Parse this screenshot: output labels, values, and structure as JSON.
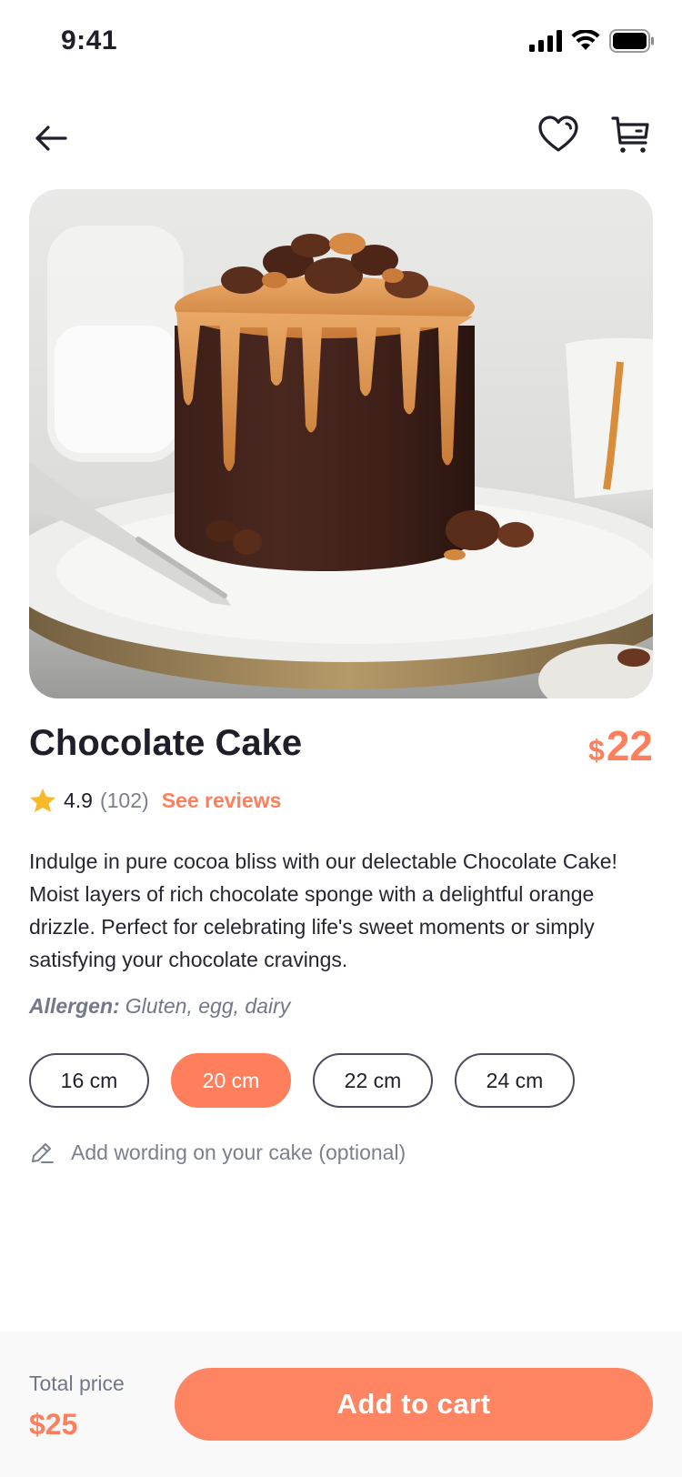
{
  "status_bar": {
    "time": "9:41"
  },
  "nav": {
    "back_icon": "arrow-left-icon",
    "favorite_icon": "heart-icon",
    "cart_icon": "shopping-cart-icon"
  },
  "product": {
    "name": "Chocolate Cake",
    "currency": "$",
    "price": "22",
    "rating": "4.9",
    "review_count": "(102)",
    "see_reviews_label": "See reviews",
    "description": "Indulge in pure cocoa bliss with our delectable Chocolate Cake! Moist layers of rich chocolate sponge with a delightful orange drizzle. Perfect for celebrating life's sweet moments or simply satisfying your chocolate cravings.",
    "allergen_label": "Allergen:",
    "allergen_value": "Gluten, egg, dairy",
    "sizes": [
      "16 cm",
      "20 cm",
      "22 cm",
      "24 cm"
    ],
    "selected_size": "20 cm",
    "wording_placeholder": "Add wording on your cake (optional)"
  },
  "footer": {
    "total_label": "Total price",
    "total_value": "$25",
    "add_to_cart_label": "Add to cart"
  },
  "colors": {
    "accent": "#ff7f5c",
    "text": "#1f1f2b",
    "muted": "#727789"
  }
}
